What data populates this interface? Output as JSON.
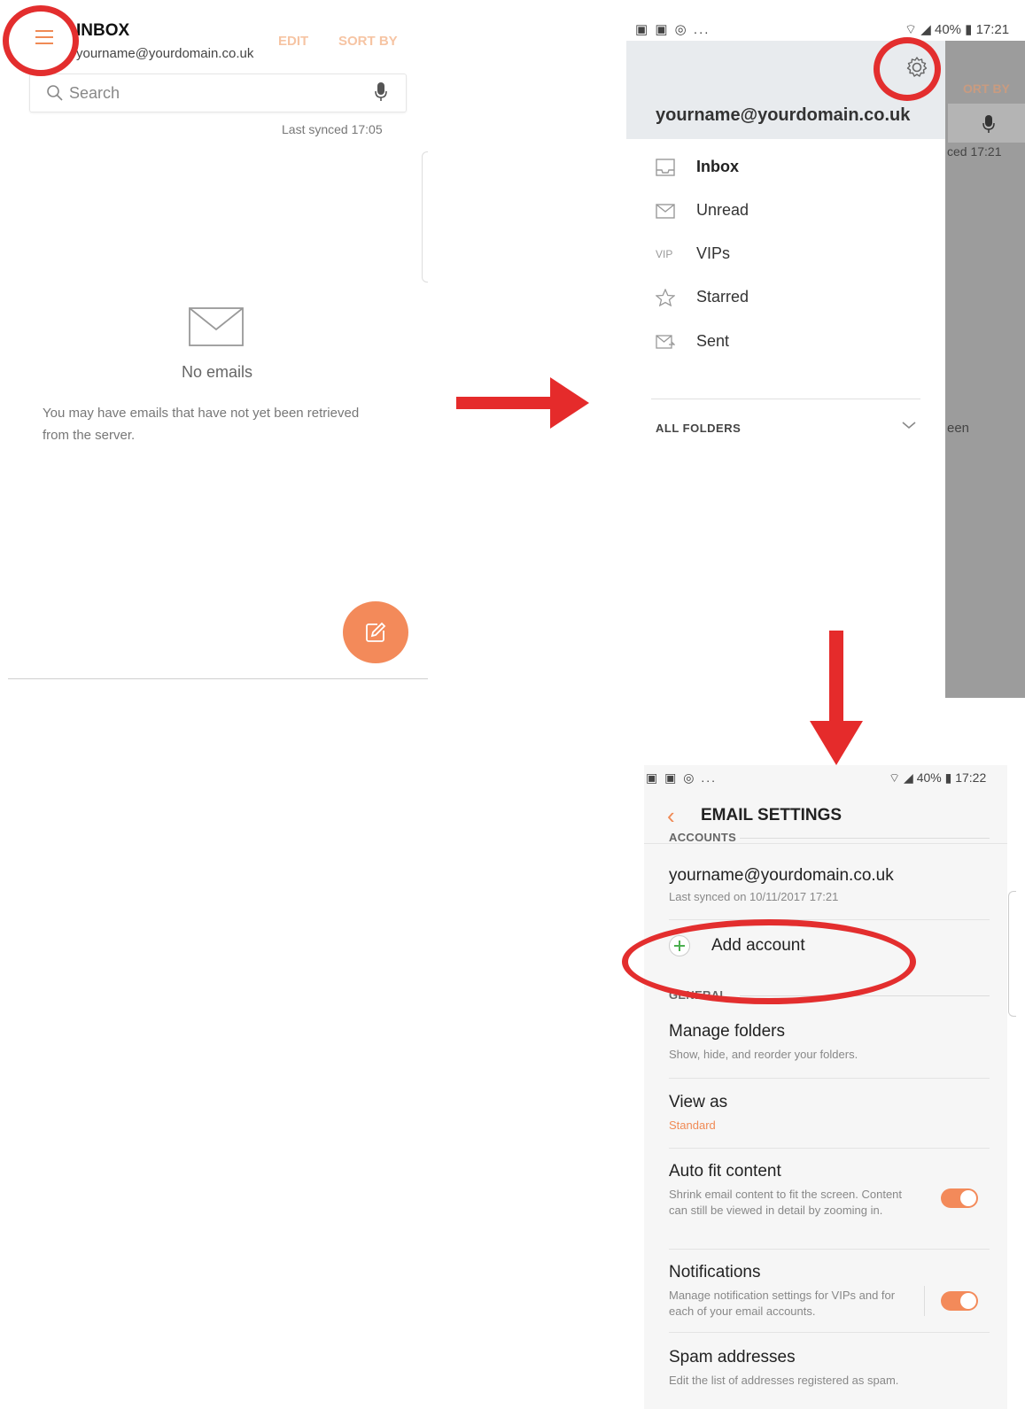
{
  "inbox_screen": {
    "title": "INBOX",
    "account": "yourname@yourdomain.co.uk",
    "edit_label": "EDIT",
    "sort_label": "SORT BY",
    "search_placeholder": "Search",
    "last_synced": "Last synced  17:05",
    "empty_title": "No emails",
    "empty_message": "You may have emails that have not yet been retrieved from the server."
  },
  "drawer_screen": {
    "status_icons": "▣ ▣ ◎ ...",
    "status_right": "⌔ ◢ 40% ▮ 17:21",
    "account": "yourname@yourdomain.co.uk",
    "items": [
      {
        "label": "Inbox",
        "icon": "inbox-icon",
        "bold": true
      },
      {
        "label": "Unread",
        "icon": "envelope-icon"
      },
      {
        "label": "VIPs",
        "icon": "vip-icon",
        "icon_text": "VIP"
      },
      {
        "label": "Starred",
        "icon": "star-icon"
      },
      {
        "label": "Sent",
        "icon": "sent-icon"
      }
    ],
    "all_folders": "ALL FOLDERS",
    "behind": {
      "sort_fragment": "ORT BY",
      "synced_fragment": "ced  17:21",
      "text_fragment": "een"
    }
  },
  "settings_screen": {
    "status_icons": "▣ ▣ ◎ ...",
    "status_right": "⌔ ◢ 40% ▮ 17:22",
    "title": "EMAIL SETTINGS",
    "accounts_section": "ACCOUNTS",
    "account": {
      "email": "yourname@yourdomain.co.uk",
      "synced": "Last synced on 10/11/2017  17:21"
    },
    "add_account": "Add account",
    "general_section": "GENERAL",
    "rows": [
      {
        "title": "Manage folders",
        "sub": "Show, hide, and reorder your folders."
      },
      {
        "title": "View as",
        "sub": "Standard"
      },
      {
        "title": "Auto fit content",
        "sub": "Shrink email content to fit the screen. Content can still be viewed in detail by zooming in.",
        "toggle": true
      },
      {
        "title": "Notifications",
        "sub": "Manage notification settings for VIPs and for each of your email accounts.",
        "toggle": true
      },
      {
        "title": "Spam addresses",
        "sub": "Edit the list of addresses registered as spam."
      }
    ]
  },
  "colors": {
    "accent": "#f38a5a",
    "highlight_red": "#e32e2e"
  }
}
